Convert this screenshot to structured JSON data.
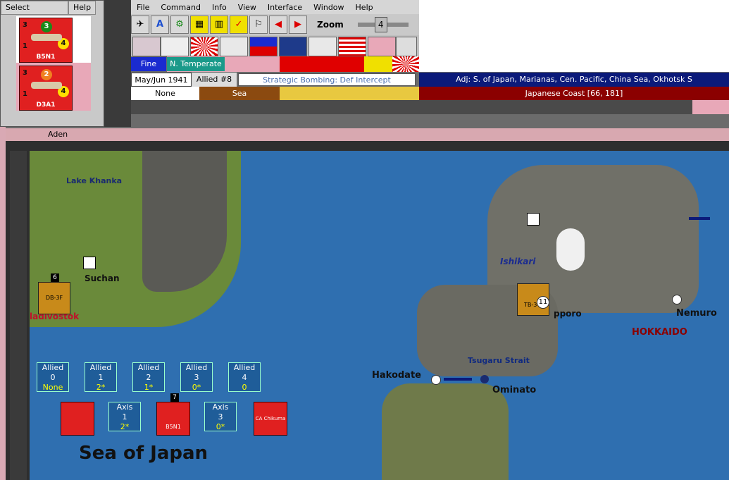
{
  "select_window": {
    "select_label": "Select",
    "help_label": "Help",
    "units": [
      {
        "name": "B5N1",
        "top_value": "3",
        "left": "3",
        "right": "4",
        "bottom_left": "1"
      },
      {
        "name": "D3A1",
        "top_value": "2",
        "left": "3",
        "right": "4",
        "bottom_left": "1"
      }
    ]
  },
  "menu": {
    "items": [
      "File",
      "Command",
      "Info",
      "View",
      "Interface",
      "Window",
      "Help"
    ]
  },
  "toolbar": {
    "zoom_label": "Zoom",
    "zoom_value": "4"
  },
  "status": {
    "weather": "Fine",
    "climate": "N. Temperate",
    "date": "May/Jun 1941",
    "impulse": "Allied #8",
    "mission": "Strategic Bombing: Def Intercept",
    "adjacent": "Adj: S. of Japan, Marianas, Cen. Pacific, China Sea, Okhotsk S",
    "row3_a": "None",
    "row3_b": "Sea",
    "location": "Japanese Coast [66, 181]"
  },
  "colors": {
    "blue_cell": "#1a2bd0",
    "teal_cell": "#1a9a8a",
    "navy": "#0b1a7a",
    "darkred": "#8b0000",
    "brown": "#8b4a10",
    "yellow": "#e8c840",
    "sea": "#2f6fb0"
  },
  "map": {
    "window_title": "Aden",
    "sea_name": "Sea of Japan",
    "labels": {
      "lake": "Lake Khanka",
      "suchan": "Suchan",
      "vladivostok": "ladivostok",
      "ishikari": "Ishikari",
      "nemuro": "Nemuro",
      "hokkaido": "HOKKAIDO",
      "tsugaru": "Tsugaru Strait",
      "hakodate": "Hakodate",
      "ominato": "Ominato",
      "sapporo": "pporo"
    },
    "boxes": [
      {
        "side": "Allied",
        "n": "0",
        "v": "None"
      },
      {
        "side": "Allied",
        "n": "1",
        "v": "2*"
      },
      {
        "side": "Allied",
        "n": "2",
        "v": "1*"
      },
      {
        "side": "Allied",
        "n": "3",
        "v": "0*"
      },
      {
        "side": "Allied",
        "n": "4",
        "v": "0"
      },
      {
        "side": "Axis",
        "n": "1",
        "v": "2*"
      },
      {
        "side": "Axis",
        "n": "3",
        "v": "0*"
      }
    ],
    "counter_labels": {
      "db": "DB-3F",
      "tb": "TB-3 5",
      "b5n1": "B5N1",
      "ca": "CA Chikuma",
      "stack7": "7",
      "stack6": "6",
      "stack11": "11"
    }
  }
}
